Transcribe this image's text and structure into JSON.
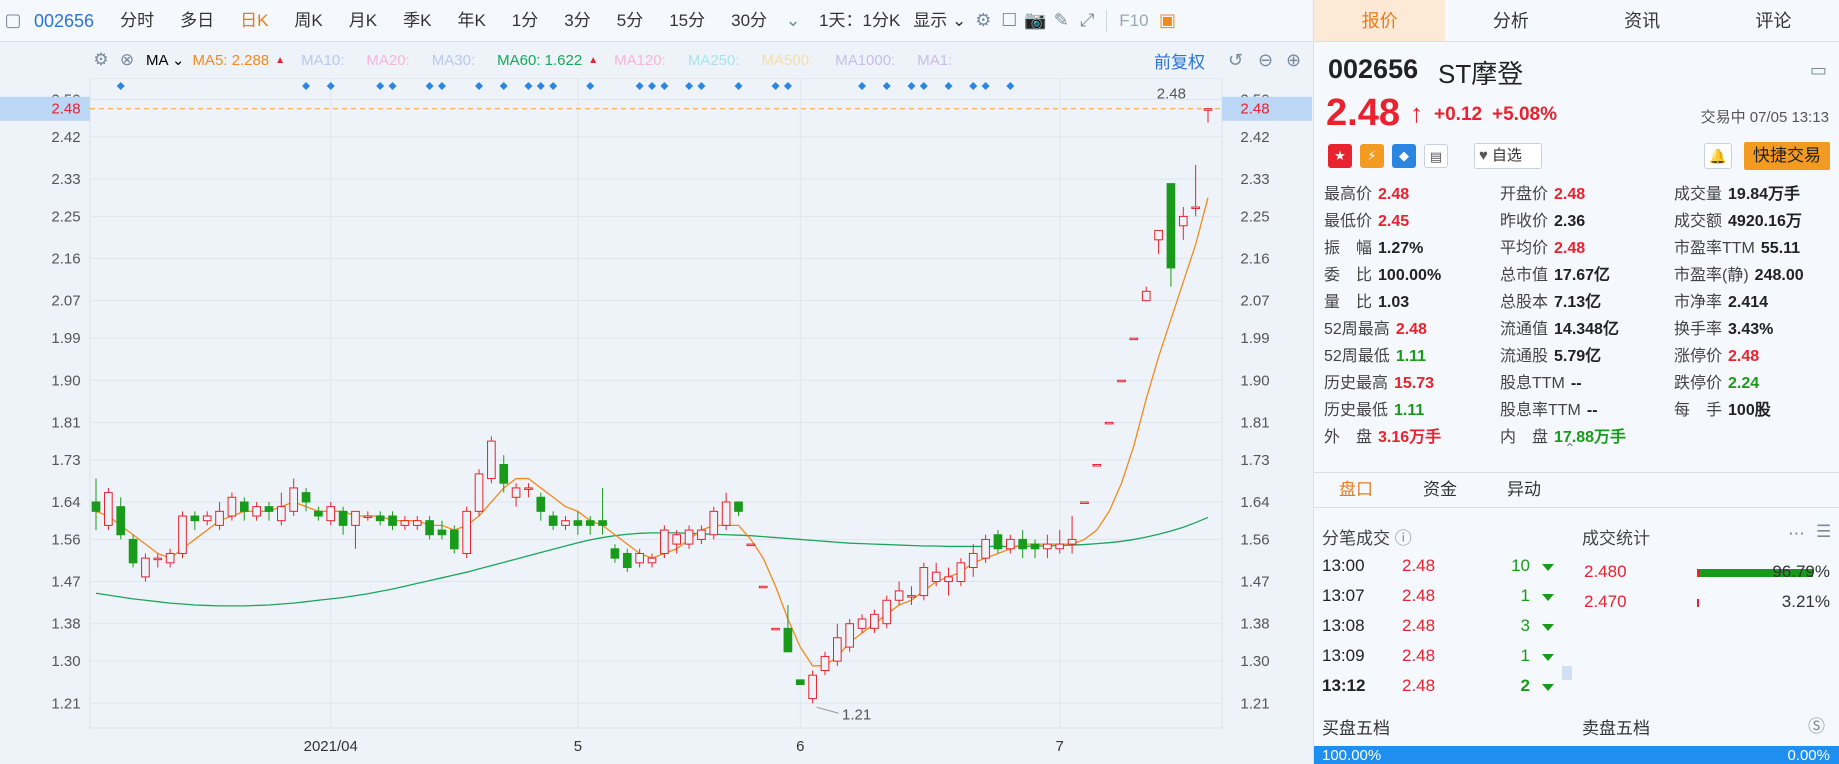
{
  "toolbar": {
    "code": "002656",
    "items": [
      "分时",
      "多日",
      "日K",
      "周K",
      "月K",
      "季K",
      "年K",
      "1分",
      "3分",
      "5分",
      "15分",
      "30分"
    ],
    "active_index": 2,
    "period_select": "1天：1分K",
    "display_label": "显示",
    "f10_label": "F10"
  },
  "ma_bar": {
    "ma_label": "MA",
    "items": [
      {
        "text": "MA5: 2.288",
        "color": "#f08a1e"
      },
      {
        "text": "MA10:",
        "color": "#b7c9ee"
      },
      {
        "text": "MA20:",
        "color": "#f5b4d8"
      },
      {
        "text": "MA30:",
        "color": "#b7c9ee"
      },
      {
        "text": "MA60: 1.622",
        "color": "#1aa65a"
      },
      {
        "text": "MA120:",
        "color": "#f5b4d8"
      },
      {
        "text": "MA250:",
        "color": "#a7e3ee"
      },
      {
        "text": "MA500:",
        "color": "#f6dda8"
      },
      {
        "text": "MA1000:",
        "color": "#c9bde8"
      },
      {
        "text": "MA1:",
        "color": "#c9bde8"
      }
    ],
    "fuquan_label": "前复权"
  },
  "chart_data": {
    "type": "candlestick",
    "ylim": [
      1.17,
      2.52
    ],
    "y_ticks": [
      "2.50",
      "2.42",
      "2.33",
      "2.25",
      "2.16",
      "2.07",
      "1.99",
      "1.90",
      "1.81",
      "1.73",
      "1.64",
      "1.56",
      "1.47",
      "1.38",
      "1.30",
      "1.21"
    ],
    "current_price_label": "2.48",
    "high_label": "2.48",
    "low_label": "1.21",
    "x_labels": [
      "2021/04",
      "5",
      "6",
      "7"
    ],
    "x_label_index": [
      19,
      39,
      57,
      78
    ],
    "candles": [
      [
        1.64,
        1.62,
        1.69,
        1.58
      ],
      [
        1.59,
        1.66,
        1.67,
        1.58
      ],
      [
        1.63,
        1.57,
        1.65,
        1.56
      ],
      [
        1.56,
        1.51,
        1.57,
        1.5
      ],
      [
        1.48,
        1.52,
        1.53,
        1.47
      ],
      [
        1.52,
        1.52,
        1.53,
        1.5
      ],
      [
        1.51,
        1.53,
        1.54,
        1.5
      ],
      [
        1.53,
        1.61,
        1.62,
        1.52
      ],
      [
        1.61,
        1.6,
        1.62,
        1.58
      ],
      [
        1.6,
        1.61,
        1.62,
        1.59
      ],
      [
        1.59,
        1.62,
        1.64,
        1.58
      ],
      [
        1.61,
        1.65,
        1.66,
        1.6
      ],
      [
        1.64,
        1.62,
        1.65,
        1.6
      ],
      [
        1.61,
        1.63,
        1.64,
        1.6
      ],
      [
        1.63,
        1.62,
        1.64,
        1.6
      ],
      [
        1.6,
        1.63,
        1.66,
        1.59
      ],
      [
        1.62,
        1.67,
        1.69,
        1.61
      ],
      [
        1.66,
        1.64,
        1.67,
        1.62
      ],
      [
        1.62,
        1.61,
        1.63,
        1.6
      ],
      [
        1.6,
        1.63,
        1.64,
        1.59
      ],
      [
        1.62,
        1.59,
        1.63,
        1.57
      ],
      [
        1.59,
        1.62,
        1.62,
        1.54
      ],
      [
        1.61,
        1.61,
        1.62,
        1.6
      ],
      [
        1.61,
        1.6,
        1.62,
        1.59
      ],
      [
        1.61,
        1.59,
        1.62,
        1.58
      ],
      [
        1.59,
        1.6,
        1.61,
        1.58
      ],
      [
        1.59,
        1.6,
        1.61,
        1.58
      ],
      [
        1.6,
        1.57,
        1.61,
        1.56
      ],
      [
        1.58,
        1.57,
        1.6,
        1.56
      ],
      [
        1.58,
        1.54,
        1.59,
        1.53
      ],
      [
        1.53,
        1.62,
        1.63,
        1.52
      ],
      [
        1.62,
        1.7,
        1.71,
        1.61
      ],
      [
        1.69,
        1.77,
        1.78,
        1.68
      ],
      [
        1.72,
        1.68,
        1.74,
        1.66
      ],
      [
        1.65,
        1.67,
        1.68,
        1.63
      ],
      [
        1.67,
        1.67,
        1.68,
        1.65
      ],
      [
        1.65,
        1.62,
        1.66,
        1.6
      ],
      [
        1.61,
        1.59,
        1.62,
        1.58
      ],
      [
        1.59,
        1.6,
        1.61,
        1.58
      ],
      [
        1.6,
        1.59,
        1.62,
        1.57
      ],
      [
        1.6,
        1.59,
        1.61,
        1.57
      ],
      [
        1.6,
        1.59,
        1.67,
        1.57
      ],
      [
        1.54,
        1.52,
        1.55,
        1.51
      ],
      [
        1.53,
        1.5,
        1.54,
        1.49
      ],
      [
        1.51,
        1.53,
        1.54,
        1.5
      ],
      [
        1.51,
        1.52,
        1.53,
        1.5
      ],
      [
        1.53,
        1.58,
        1.59,
        1.52
      ],
      [
        1.55,
        1.57,
        1.58,
        1.53
      ],
      [
        1.55,
        1.58,
        1.59,
        1.54
      ],
      [
        1.56,
        1.58,
        1.59,
        1.55
      ],
      [
        1.57,
        1.62,
        1.63,
        1.56
      ],
      [
        1.59,
        1.64,
        1.66,
        1.58
      ],
      [
        1.64,
        1.62,
        1.64,
        1.61
      ],
      [
        1.55,
        1.55,
        1.55,
        1.55
      ],
      [
        1.46,
        1.46,
        1.46,
        1.46
      ],
      [
        1.37,
        1.37,
        1.37,
        1.37
      ],
      [
        1.37,
        1.32,
        1.42,
        1.32
      ],
      [
        1.26,
        1.25,
        1.26,
        1.25
      ],
      [
        1.22,
        1.27,
        1.28,
        1.21
      ],
      [
        1.28,
        1.31,
        1.32,
        1.27
      ],
      [
        1.3,
        1.35,
        1.38,
        1.29
      ],
      [
        1.33,
        1.38,
        1.39,
        1.32
      ],
      [
        1.37,
        1.39,
        1.4,
        1.36
      ],
      [
        1.37,
        1.4,
        1.41,
        1.36
      ],
      [
        1.38,
        1.43,
        1.44,
        1.37
      ],
      [
        1.43,
        1.45,
        1.47,
        1.42
      ],
      [
        1.44,
        1.44,
        1.46,
        1.42
      ],
      [
        1.44,
        1.5,
        1.51,
        1.43
      ],
      [
        1.47,
        1.49,
        1.51,
        1.46
      ],
      [
        1.47,
        1.48,
        1.5,
        1.44
      ],
      [
        1.47,
        1.51,
        1.52,
        1.46
      ],
      [
        1.5,
        1.53,
        1.55,
        1.48
      ],
      [
        1.52,
        1.56,
        1.57,
        1.51
      ],
      [
        1.57,
        1.54,
        1.58,
        1.53
      ],
      [
        1.54,
        1.56,
        1.57,
        1.53
      ],
      [
        1.56,
        1.54,
        1.58,
        1.52
      ],
      [
        1.55,
        1.54,
        1.56,
        1.52
      ],
      [
        1.54,
        1.55,
        1.57,
        1.52
      ],
      [
        1.54,
        1.55,
        1.58,
        1.53
      ],
      [
        1.55,
        1.56,
        1.61,
        1.53
      ],
      [
        1.64,
        1.64,
        1.64,
        1.64
      ],
      [
        1.72,
        1.72,
        1.72,
        1.72
      ],
      [
        1.81,
        1.81,
        1.81,
        1.81
      ],
      [
        1.9,
        1.9,
        1.9,
        1.9
      ],
      [
        1.99,
        1.99,
        1.99,
        1.99
      ],
      [
        2.07,
        2.09,
        2.1,
        2.07
      ],
      [
        2.2,
        2.22,
        2.22,
        2.17
      ],
      [
        2.32,
        2.14,
        2.32,
        2.1
      ],
      [
        2.23,
        2.25,
        2.27,
        2.2
      ],
      [
        2.27,
        2.27,
        2.36,
        2.25
      ],
      [
        2.48,
        2.48,
        2.48,
        2.45
      ]
    ],
    "ma5": [
      1.62,
      1.61,
      1.59,
      1.57,
      1.55,
      1.53,
      1.52,
      1.54,
      1.56,
      1.58,
      1.6,
      1.61,
      1.62,
      1.62,
      1.62,
      1.63,
      1.64,
      1.63,
      1.62,
      1.62,
      1.62,
      1.61,
      1.61,
      1.61,
      1.6,
      1.6,
      1.6,
      1.59,
      1.59,
      1.58,
      1.59,
      1.61,
      1.64,
      1.67,
      1.69,
      1.69,
      1.67,
      1.65,
      1.63,
      1.62,
      1.6,
      1.59,
      1.57,
      1.55,
      1.53,
      1.52,
      1.53,
      1.54,
      1.56,
      1.58,
      1.59,
      1.59,
      1.59,
      1.56,
      1.52,
      1.46,
      1.39,
      1.33,
      1.29,
      1.29,
      1.31,
      1.34,
      1.36,
      1.38,
      1.4,
      1.42,
      1.43,
      1.45,
      1.47,
      1.48,
      1.49,
      1.51,
      1.52,
      1.53,
      1.54,
      1.55,
      1.55,
      1.55,
      1.55,
      1.55,
      1.56,
      1.58,
      1.62,
      1.68,
      1.76,
      1.86,
      1.95,
      2.03,
      2.11,
      2.19,
      2.29
    ],
    "ma60": [
      1.445,
      1.441,
      1.437,
      1.433,
      1.43,
      1.427,
      1.424,
      1.422,
      1.42,
      1.419,
      1.418,
      1.418,
      1.418,
      1.419,
      1.42,
      1.422,
      1.424,
      1.427,
      1.43,
      1.433,
      1.436,
      1.44,
      1.444,
      1.449,
      1.454,
      1.46,
      1.466,
      1.472,
      1.478,
      1.484,
      1.49,
      1.497,
      1.504,
      1.511,
      1.518,
      1.525,
      1.532,
      1.539,
      1.546,
      1.553,
      1.559,
      1.564,
      1.568,
      1.571,
      1.573,
      1.574,
      1.574,
      1.574,
      1.573,
      1.572,
      1.571,
      1.57,
      1.569,
      1.568,
      1.566,
      1.564,
      1.562,
      1.56,
      1.558,
      1.556,
      1.554,
      1.552,
      1.551,
      1.55,
      1.549,
      1.548,
      1.547,
      1.546,
      1.546,
      1.545,
      1.545,
      1.545,
      1.545,
      1.545,
      1.545,
      1.545,
      1.546,
      1.546,
      1.547,
      1.548,
      1.549,
      1.551,
      1.553,
      1.556,
      1.56,
      1.565,
      1.571,
      1.578,
      1.586,
      1.596,
      1.607
    ]
  },
  "quote": {
    "tabs": [
      "报价",
      "分析",
      "资讯",
      "评论"
    ],
    "active_tab": 0,
    "code": "002656",
    "name": "ST摩登",
    "price": "2.48",
    "change": "+0.12",
    "change_pct": "+5.08%",
    "status": "交易中 07/05 13:13",
    "zixuan_label": "自选",
    "quick_trade_label": "快捷交易",
    "stats": [
      [
        {
          "label": "最高价",
          "value": "2.48",
          "c": "red"
        },
        {
          "label": "开盘价",
          "value": "2.48",
          "c": "red"
        },
        {
          "label": "成交量",
          "value": "19.84万手",
          "c": "dark"
        }
      ],
      [
        {
          "label": "最低价",
          "value": "2.45",
          "c": "red"
        },
        {
          "label": "昨收价",
          "value": "2.36",
          "c": "dark"
        },
        {
          "label": "成交额",
          "value": "4920.16万",
          "c": "dark"
        }
      ],
      [
        {
          "label": "振　幅",
          "value": "1.27%",
          "c": "dark"
        },
        {
          "label": "平均价",
          "value": "2.48",
          "c": "red"
        },
        {
          "label": "市盈率TTM",
          "value": "55.11",
          "c": "dark"
        }
      ],
      [
        {
          "label": "委　比",
          "value": "100.00%",
          "c": "dark"
        },
        {
          "label": "总市值",
          "value": "17.67亿",
          "c": "dark"
        },
        {
          "label": "市盈率(静)",
          "value": "248.00",
          "c": "dark"
        }
      ],
      [
        {
          "label": "量　比",
          "value": "1.03",
          "c": "dark"
        },
        {
          "label": "总股本",
          "value": "7.13亿",
          "c": "dark"
        },
        {
          "label": "市净率",
          "value": "2.414",
          "c": "dark"
        }
      ],
      [
        {
          "label": "52周最高",
          "value": "2.48",
          "c": "red"
        },
        {
          "label": "流通值",
          "value": "14.348亿",
          "c": "dark"
        },
        {
          "label": "换手率",
          "value": "3.43%",
          "c": "dark"
        }
      ],
      [
        {
          "label": "52周最低",
          "value": "1.11",
          "c": "green"
        },
        {
          "label": "流通股",
          "value": "5.79亿",
          "c": "dark"
        },
        {
          "label": "涨停价",
          "value": "2.48",
          "c": "red"
        }
      ],
      [
        {
          "label": "历史最高",
          "value": "15.73",
          "c": "red"
        },
        {
          "label": "股息TTM",
          "value": "--",
          "c": "dark"
        },
        {
          "label": "跌停价",
          "value": "2.24",
          "c": "green"
        }
      ],
      [
        {
          "label": "历史最低",
          "value": "1.11",
          "c": "green"
        },
        {
          "label": "股息率TTM",
          "value": "--",
          "c": "dark"
        },
        {
          "label": "每　手",
          "value": "100股",
          "c": "dark"
        }
      ],
      [
        {
          "label": "外　盘",
          "value": "3.16万手",
          "c": "red"
        },
        {
          "label": "内　盘",
          "value": "17.88万手",
          "c": "green"
        }
      ]
    ],
    "subtabs": [
      "盘口",
      "资金",
      "异动"
    ],
    "trades_header": "分笔成交",
    "stats_header": "成交统计",
    "trades": [
      {
        "time": "13:00",
        "price": "2.48",
        "vol": "10"
      },
      {
        "time": "13:07",
        "price": "2.48",
        "vol": "1"
      },
      {
        "time": "13:08",
        "price": "2.48",
        "vol": "3"
      },
      {
        "time": "13:09",
        "price": "2.48",
        "vol": "1"
      },
      {
        "time": "13:12",
        "price": "2.48",
        "vol": "2"
      }
    ],
    "dist": [
      {
        "price": "2.480",
        "pct": "96.79%",
        "red_ratio": 0.03,
        "green_ratio": 0.97
      },
      {
        "price": "2.470",
        "pct": "3.21%",
        "red_ratio": 1,
        "green_ratio": 0
      }
    ],
    "buy5": "买盘五档",
    "sell5": "卖盘五档",
    "buy_pct": "100.00%",
    "sell_pct": "0.00%"
  }
}
